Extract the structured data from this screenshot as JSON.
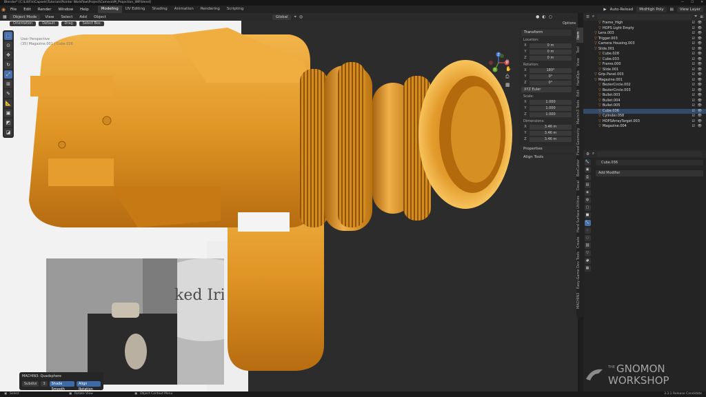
{
  "title_bar": {
    "text": "Blender* [C:\\Lit\\Fin\\Capsels\\Tutorials\\Pointer Workflow\\Project\\Camera\\M_Projection_WIP.blend]"
  },
  "top_menu": {
    "items": [
      "File",
      "Edit",
      "Render",
      "Window",
      "Help"
    ],
    "workspaces": [
      "Modeling",
      "UV Editing",
      "Shading",
      "Animation",
      "Rendering",
      "Scripting"
    ],
    "active_workspace": "Modeling",
    "auto_reload": "Auto-Reload",
    "scene": "MidHigh Poly",
    "view_layer": "View Layer"
  },
  "viewport_header": {
    "mode": "Object Mode",
    "menus": [
      "View",
      "Select",
      "Add",
      "Object"
    ],
    "transform": "Global",
    "options": "Options"
  },
  "tool_settings": {
    "orientation": "Orientation",
    "default": "Default",
    "drag": "Drag",
    "select": "Select Box"
  },
  "viewport_overlay": {
    "line1": "User Perspective",
    "line2": "(35) Magazine.001 | Cube.036"
  },
  "gizmo": {
    "x": "X",
    "y": "Y",
    "z": "Z"
  },
  "transform_panel": {
    "header": "Transform",
    "location_label": "Location:",
    "location": {
      "x": "0 m",
      "y": "0 m",
      "z": "0 m"
    },
    "rotation_label": "Rotation:",
    "rotation": {
      "x": "180°",
      "y": "0°",
      "z": "0°"
    },
    "rotation_mode": "XYZ Euler",
    "scale_label": "Scale:",
    "scale": {
      "x": "1.000",
      "y": "1.000",
      "z": "1.000"
    },
    "dimensions_label": "Dimensions:",
    "dimensions": {
      "x": "3.46 m",
      "y": "3.46 m",
      "z": "3.46 m"
    },
    "properties": "Properties",
    "align_tools": "Align Tools"
  },
  "vertical_tabs": [
    "Item",
    "Tool",
    "View",
    "HardOps",
    "Edit",
    "Machin3 Tools",
    "Fixed Geometry",
    "BoxCutter",
    "Decal",
    "Hard Surface Utilities",
    "Create",
    "Easy-Game Dev Tools",
    "MACHIN3"
  ],
  "outliner": {
    "rows": [
      {
        "name": "Frame_High",
        "indent": 3,
        "selected": false
      },
      {
        "name": "HOPS Light Empty",
        "indent": 3,
        "selected": false
      },
      {
        "name": "Lens.003",
        "indent": 2,
        "selected": false
      },
      {
        "name": "Trigger.003",
        "indent": 2,
        "selected": false
      },
      {
        "name": "Camera Housing.003",
        "indent": 2,
        "selected": false
      },
      {
        "name": "Slide.001",
        "indent": 2,
        "selected": false
      },
      {
        "name": "Cube.028",
        "indent": 3,
        "selected": false
      },
      {
        "name": "Cube.033",
        "indent": 3,
        "selected": false
      },
      {
        "name": "Frame.000",
        "indent": 3,
        "selected": false
      },
      {
        "name": "Slide.001",
        "indent": 3,
        "selected": false
      },
      {
        "name": "Grip.Panel.003",
        "indent": 2,
        "selected": false
      },
      {
        "name": "Magazine.001",
        "indent": 2,
        "selected": false
      },
      {
        "name": "BezierCircle.002",
        "indent": 3,
        "selected": false
      },
      {
        "name": "BezierCircle.003",
        "indent": 3,
        "selected": false
      },
      {
        "name": "Bullet.003",
        "indent": 3,
        "selected": false
      },
      {
        "name": "Bullet.004",
        "indent": 3,
        "selected": false
      },
      {
        "name": "Bullet.005",
        "indent": 3,
        "selected": false
      },
      {
        "name": "Cube.036",
        "indent": 3,
        "selected": true
      },
      {
        "name": "Cylinder.058",
        "indent": 3,
        "selected": false
      },
      {
        "name": "HOPSArrayTarget.003",
        "indent": 3,
        "selected": false
      },
      {
        "name": "Magazine.004",
        "indent": 3,
        "selected": false
      }
    ]
  },
  "properties": {
    "object_name": "Cube.036",
    "add_modifier": "Add Modifier"
  },
  "operator_panel": {
    "title": "MACHIN3: Quadsphere",
    "subdivide_label": "Subdivi",
    "subdivide_value": "3",
    "shade_smooth": "Shade Smooth",
    "align_rotation": "Align Rotation"
  },
  "reference_photo": {
    "text": "ked Iris"
  },
  "watermark": {
    "the": "THE",
    "gnomon": "GNOMON",
    "workshop": "WORKSHOP"
  },
  "statusbar": {
    "select": "Select",
    "rotate": "Rotate View",
    "context": "Object Context Menu",
    "version": "3.3.1 Release Candidate"
  },
  "colors": {
    "accent_blue": "#4a6ea8",
    "selected_row": "#334a6b",
    "object_orange": "#e0943a"
  }
}
